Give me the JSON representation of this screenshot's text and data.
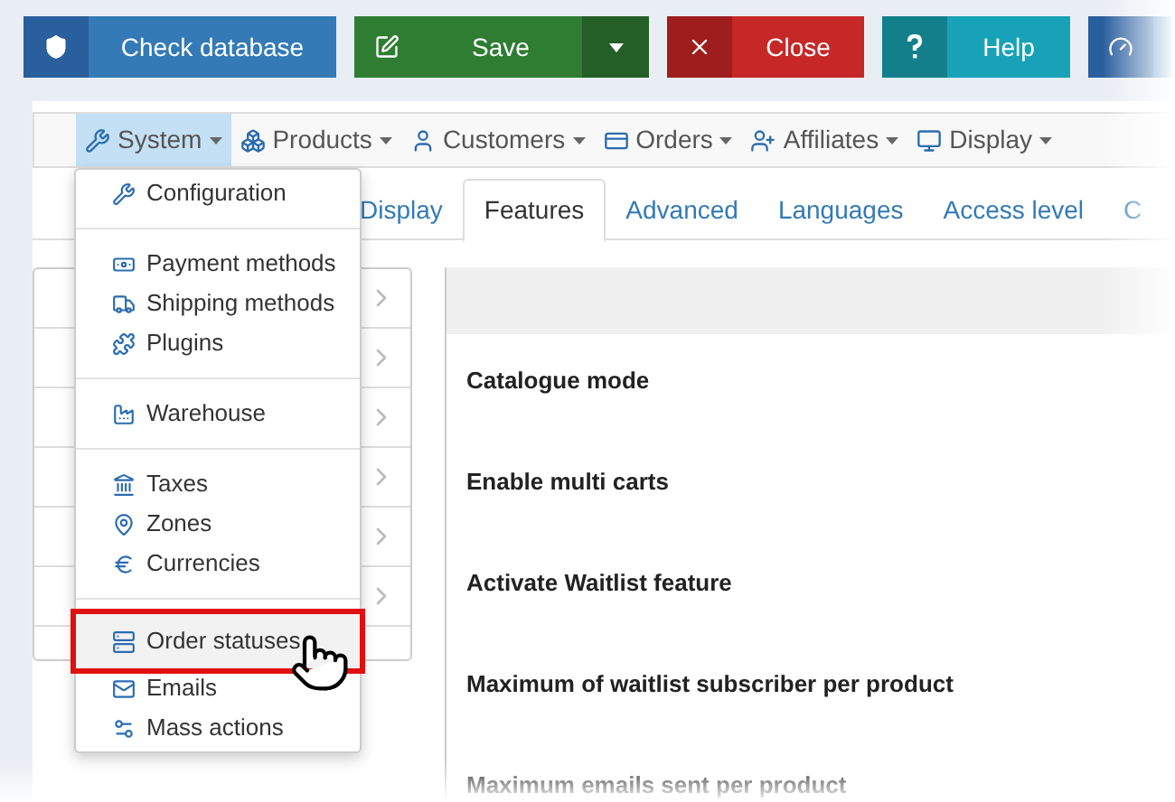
{
  "toolbar": [
    {
      "kind": "database",
      "label": "Check database"
    },
    {
      "kind": "save",
      "label": "Save",
      "split": true
    },
    {
      "kind": "close",
      "label": "Close"
    },
    {
      "kind": "help",
      "label": "Help"
    },
    {
      "kind": "dashboard"
    }
  ],
  "menu": [
    {
      "kind": "system",
      "label": "System",
      "selected": true
    },
    {
      "kind": "products",
      "label": "Products",
      "selected": false
    },
    {
      "kind": "customers",
      "label": "Customers",
      "selected": false
    },
    {
      "kind": "orders",
      "label": "Orders",
      "selected": false
    },
    {
      "kind": "affiliates",
      "label": "Affiliates",
      "selected": false
    },
    {
      "kind": "display",
      "label": "Display",
      "selected": false
    }
  ],
  "dropdown": [
    [
      {
        "kind": "configuration",
        "label": "Configuration",
        "selected": false
      }
    ],
    [
      {
        "kind": "payment",
        "label": "Payment methods",
        "selected": false
      },
      {
        "kind": "shipping",
        "label": "Shipping methods",
        "selected": false
      },
      {
        "kind": "plugins",
        "label": "Plugins",
        "selected": false
      }
    ],
    [
      {
        "kind": "warehouse",
        "label": "Warehouse",
        "selected": false
      }
    ],
    [
      {
        "kind": "taxes",
        "label": "Taxes",
        "selected": false
      },
      {
        "kind": "zones",
        "label": "Zones",
        "selected": false
      },
      {
        "kind": "currencies",
        "label": "Currencies",
        "selected": false
      }
    ],
    [
      {
        "kind": "statuses",
        "label": "Order statuses",
        "selected": true
      },
      {
        "kind": "emails",
        "label": "Emails",
        "selected": false
      },
      {
        "kind": "mass",
        "label": "Mass actions",
        "selected": false
      }
    ]
  ],
  "tabs": [
    {
      "label": "Display",
      "selected": false
    },
    {
      "label": "Features",
      "selected": true
    },
    {
      "label": "Advanced",
      "selected": false
    },
    {
      "label": "Languages",
      "selected": false
    },
    {
      "label": "Access level",
      "selected": false
    },
    {
      "label": "C",
      "selected": false
    }
  ],
  "settings": [
    "Catalogue mode",
    "Enable multi carts",
    "Activate Waitlist feature",
    "Maximum of waitlist subscriber per product",
    "Maximum emails sent per product"
  ]
}
